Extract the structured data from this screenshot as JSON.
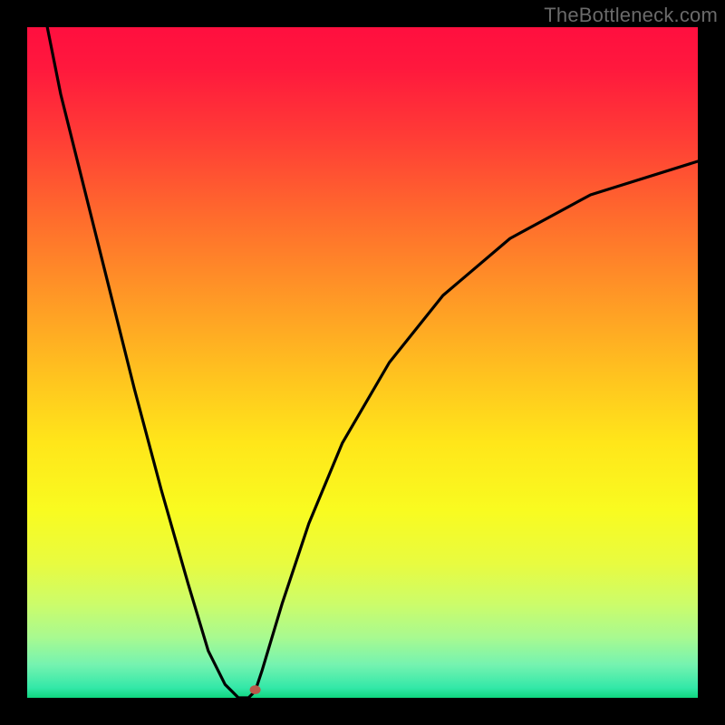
{
  "watermark": "TheBottleneck.com",
  "chart_data": {
    "type": "line",
    "title": "",
    "xlabel": "",
    "ylabel": "",
    "xlim": [
      0,
      100
    ],
    "ylim": [
      0,
      100
    ],
    "grid": false,
    "series": [
      {
        "name": "bottleneck-curve",
        "x": [
          3,
          5,
          8,
          12,
          16,
          20,
          24,
          27,
          29.5,
          31.5,
          33,
          34,
          34,
          35,
          38,
          42,
          47,
          54,
          62,
          72,
          84,
          100
        ],
        "y": [
          100,
          90,
          78,
          62,
          46,
          31,
          17,
          7,
          2,
          0,
          0,
          1,
          1,
          4,
          14,
          26,
          38,
          50,
          60,
          68.5,
          75,
          80
        ]
      }
    ],
    "markers": [
      {
        "name": "optimal-point",
        "x": 34,
        "y": 1.2,
        "color": "#b85a4a",
        "rx": 6,
        "ry": 5
      }
    ],
    "gradient_stops": [
      {
        "offset": 0.0,
        "color": "#ff0f3f"
      },
      {
        "offset": 0.06,
        "color": "#ff183d"
      },
      {
        "offset": 0.16,
        "color": "#ff3b36"
      },
      {
        "offset": 0.28,
        "color": "#ff6a2d"
      },
      {
        "offset": 0.4,
        "color": "#ff9726"
      },
      {
        "offset": 0.52,
        "color": "#ffc31f"
      },
      {
        "offset": 0.62,
        "color": "#ffe61a"
      },
      {
        "offset": 0.72,
        "color": "#f9fb20"
      },
      {
        "offset": 0.8,
        "color": "#e8fb40"
      },
      {
        "offset": 0.86,
        "color": "#ccfc6a"
      },
      {
        "offset": 0.91,
        "color": "#a8fa90"
      },
      {
        "offset": 0.95,
        "color": "#76f3b0"
      },
      {
        "offset": 0.985,
        "color": "#33e8a8"
      },
      {
        "offset": 1.0,
        "color": "#0fd67f"
      }
    ]
  }
}
